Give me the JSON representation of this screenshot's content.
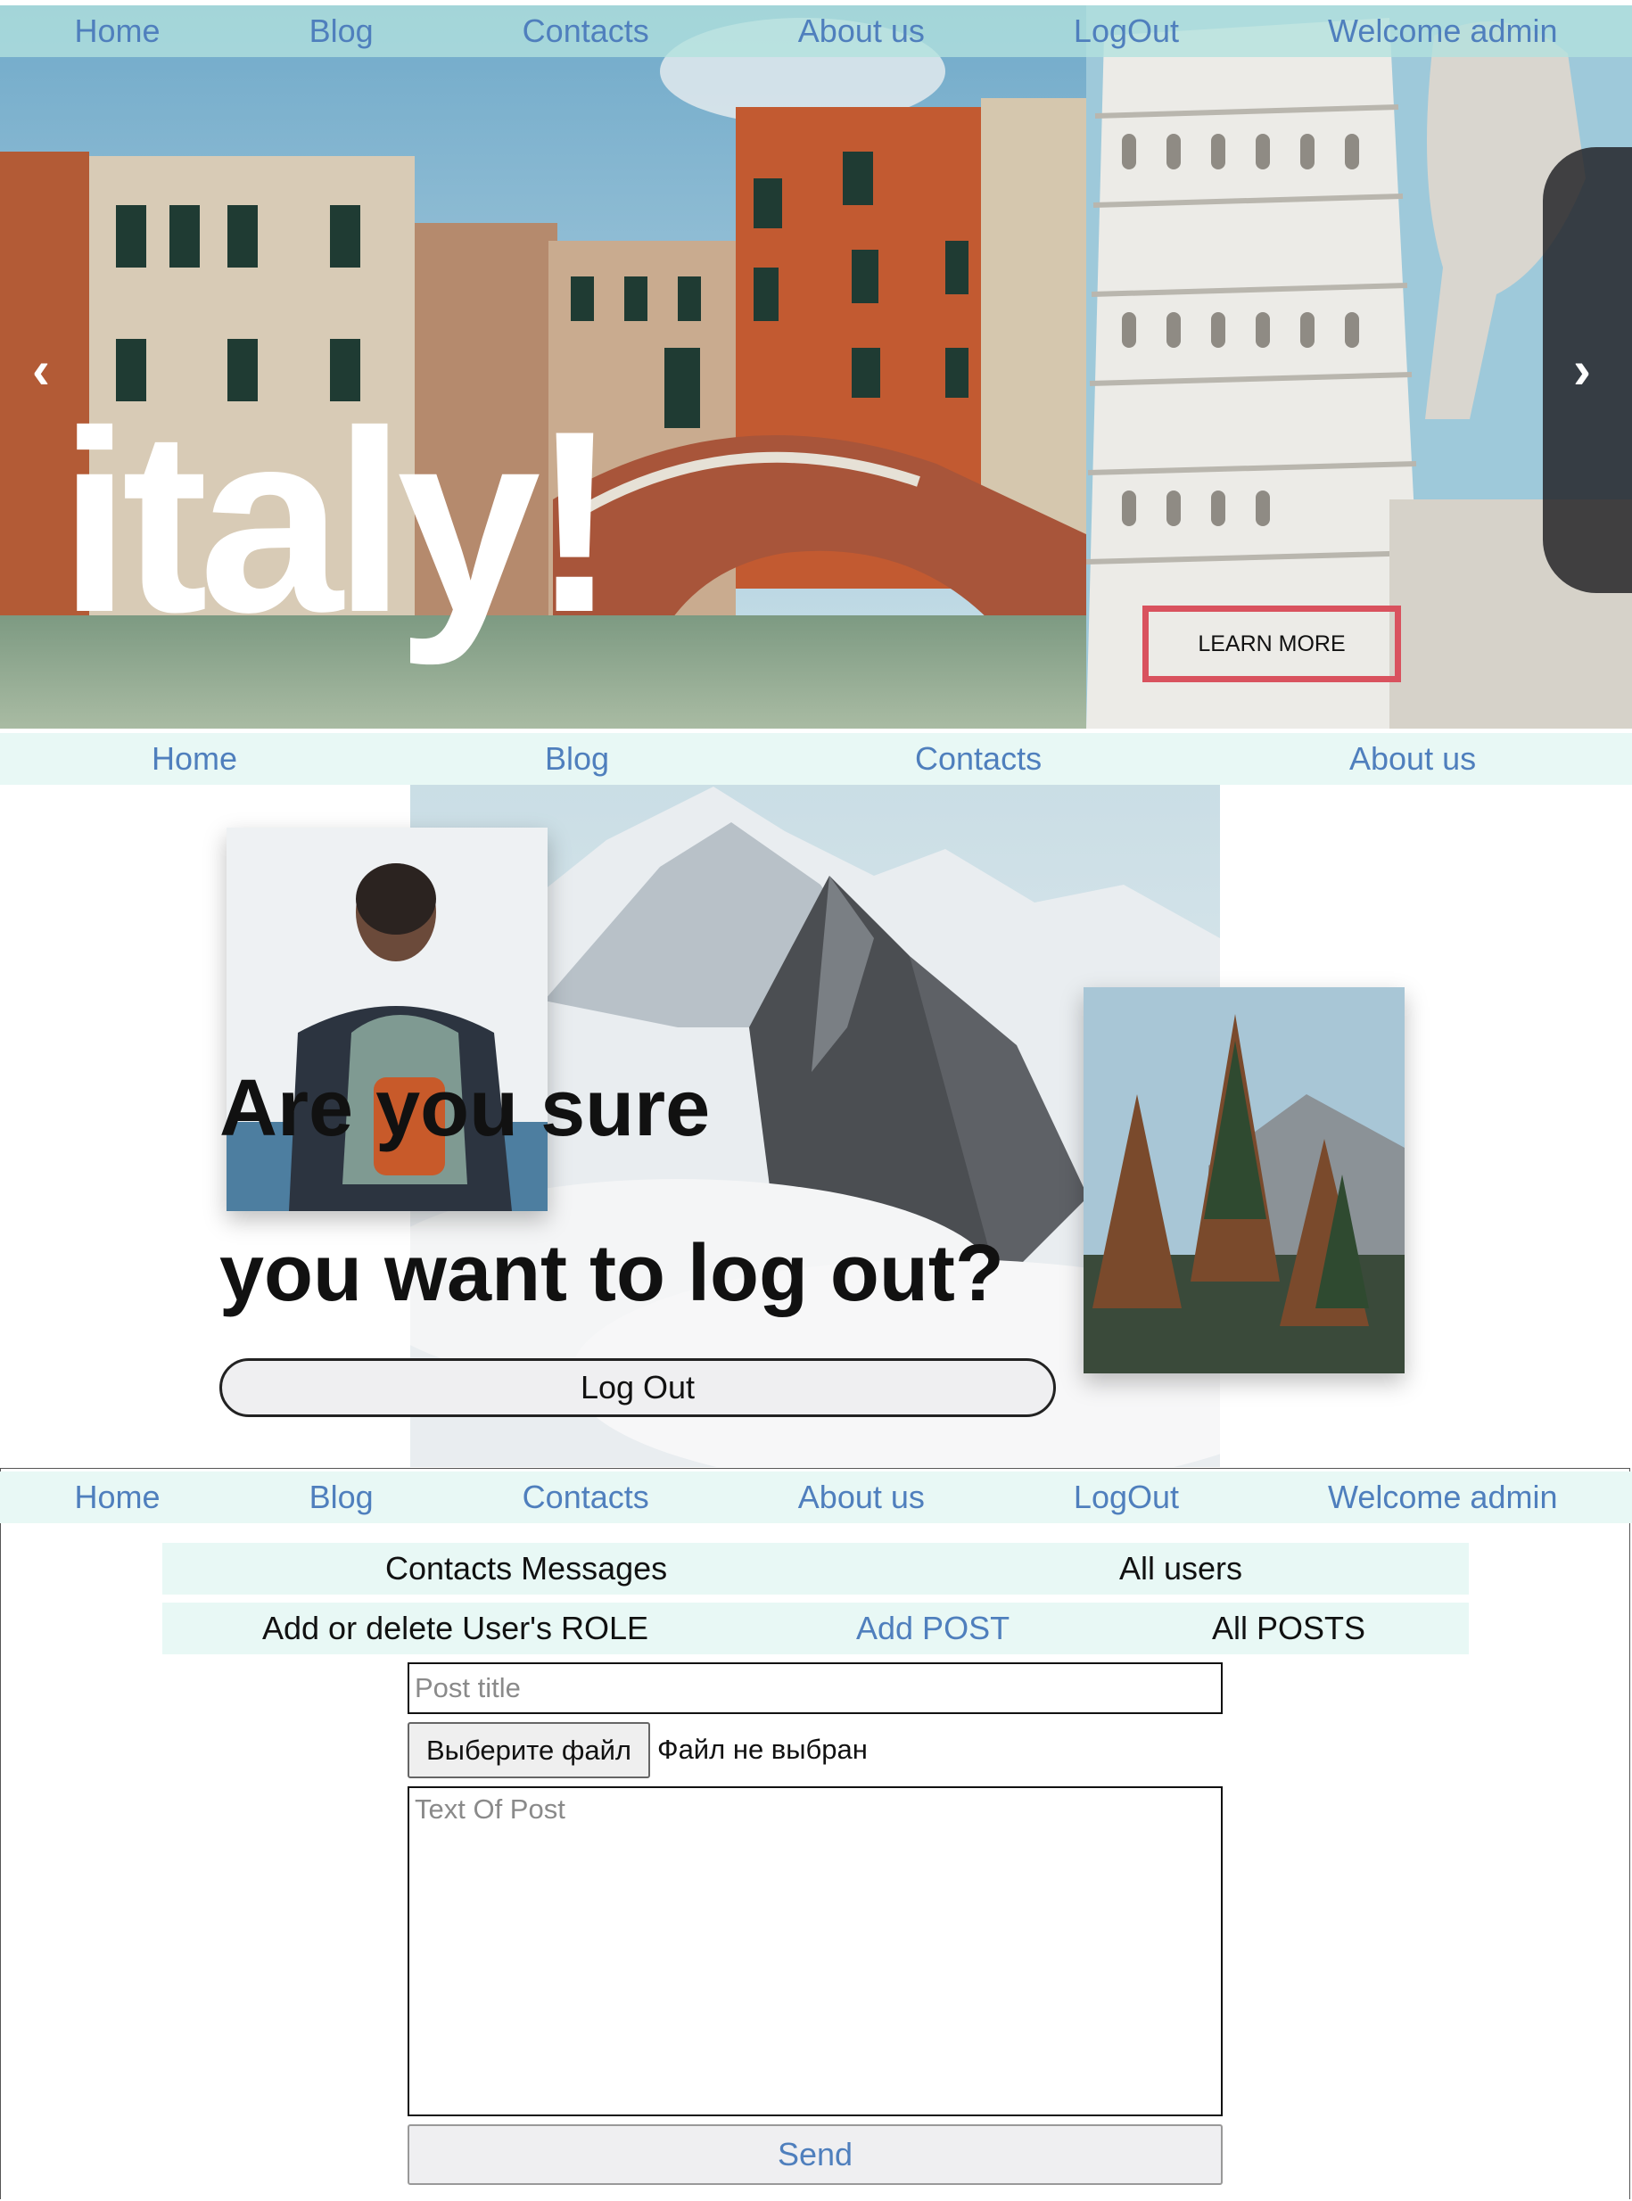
{
  "nav_top": {
    "home": "Home",
    "blog": "Blog",
    "contacts": "Contacts",
    "about": "About us",
    "logout": "LogOut",
    "welcome": "Welcome admin"
  },
  "hero": {
    "title": "italy!",
    "prev": "‹",
    "next": "›",
    "learn_more": "LEARN MORE"
  },
  "nav_logout": {
    "home": "Home",
    "blog": "Blog",
    "contacts": "Contacts",
    "about": "About us"
  },
  "logout": {
    "question_line1": "Are you sure",
    "question_line2": "you want to log out?",
    "button": "Log Out"
  },
  "nav_admin": {
    "home": "Home",
    "blog": "Blog",
    "contacts": "Contacts",
    "about": "About us",
    "logout": "LogOut",
    "welcome": "Welcome admin"
  },
  "admin": {
    "contacts_messages": "Contacts Messages",
    "all_users": "All users",
    "user_role": "Add or delete User's ROLE",
    "add_post": "Add POST",
    "all_posts": "All POSTS"
  },
  "form": {
    "title_placeholder": "Post title",
    "file_button": "Выберите файл",
    "file_status": "Файл не выбран",
    "text_placeholder": "Text Of Post",
    "send": "Send"
  },
  "colors": {
    "link": "#4f7fbd",
    "nav_bg": "#e8f8f5",
    "learn_more_border": "#d9525e"
  }
}
